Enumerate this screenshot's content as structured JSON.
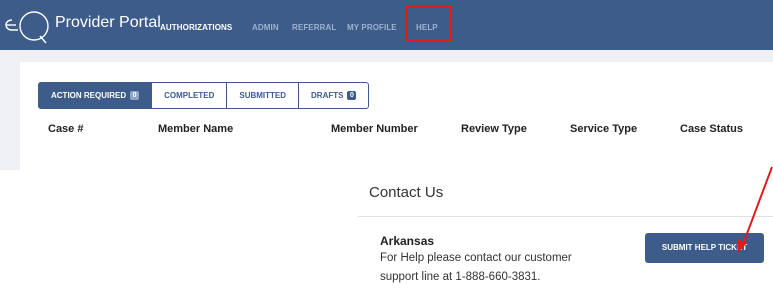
{
  "header": {
    "brand": "Provider Portal",
    "nav": [
      "AUTHORIZATIONS",
      "ADMIN",
      "REFERRAL",
      "MY PROFILE",
      "HELP"
    ]
  },
  "tabs": [
    {
      "label": "ACTION REQUIRED",
      "badge": "0"
    },
    {
      "label": "COMPLETED"
    },
    {
      "label": "SUBMITTED"
    },
    {
      "label": "DRAFTS",
      "badge": "0"
    }
  ],
  "table": {
    "columns": [
      "Case #",
      "Member Name",
      "Member Number",
      "Review Type",
      "Service Type",
      "Case Status"
    ]
  },
  "contact": {
    "title": "Contact Us",
    "state": "Arkansas",
    "text": "For Help please contact our customer support line at 1-888-660-3831.",
    "button": "SUBMIT HELP TICKET"
  },
  "colors": {
    "nav_bg": "#3d5c8a",
    "highlight": "#e11b1b"
  }
}
